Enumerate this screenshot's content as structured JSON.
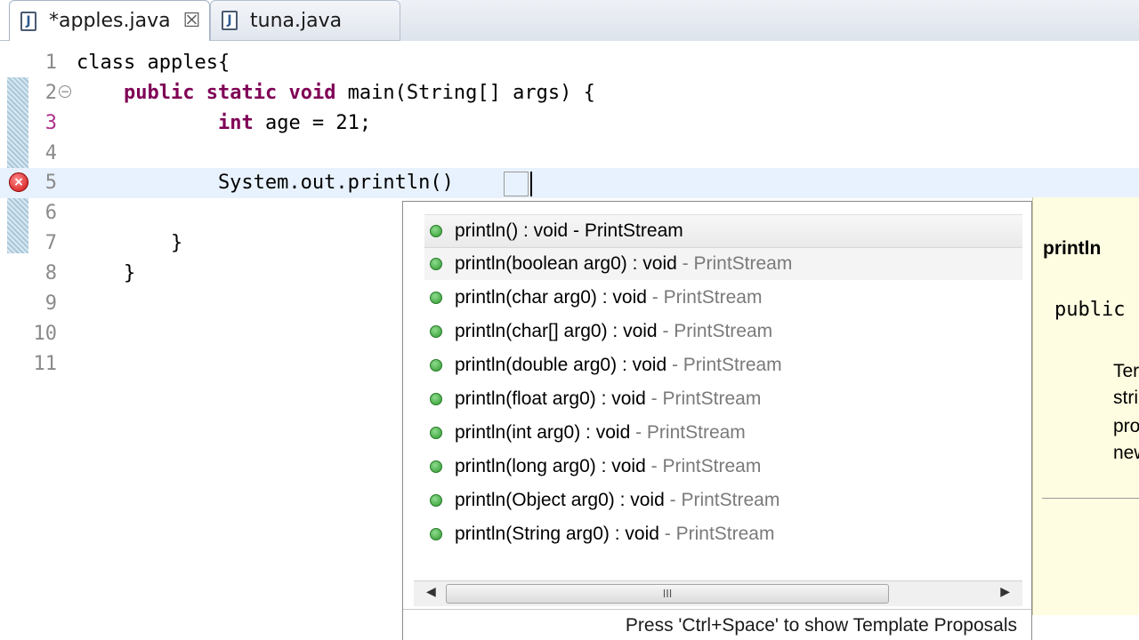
{
  "tabs": [
    {
      "label": "*apples.java",
      "active": true,
      "close_glyph": "☒",
      "icon": "java-file-icon"
    },
    {
      "label": "tuna.java",
      "active": false,
      "icon": "java-file-icon"
    }
  ],
  "editor": {
    "lines": [
      {
        "num": "1",
        "parts": [
          {
            "kw": false,
            "text": "class apples{"
          }
        ]
      },
      {
        "num": "2",
        "parts": [
          {
            "kw": false,
            "text": "    "
          },
          {
            "kw": true,
            "text": "public"
          },
          {
            "kw": false,
            "text": " "
          },
          {
            "kw": true,
            "text": "static"
          },
          {
            "kw": false,
            "text": " "
          },
          {
            "kw": true,
            "text": "void"
          },
          {
            "kw": false,
            "text": " main(String[] args) {"
          }
        ]
      },
      {
        "num": "3",
        "parts": [
          {
            "kw": false,
            "text": "            "
          },
          {
            "kw": true,
            "text": "int"
          },
          {
            "kw": false,
            "text": " age = 21;"
          }
        ]
      },
      {
        "num": "4",
        "parts": [
          {
            "kw": false,
            "text": ""
          }
        ]
      },
      {
        "num": "5",
        "parts": [
          {
            "kw": false,
            "text": "            System.out.println()"
          }
        ]
      },
      {
        "num": "6",
        "parts": [
          {
            "kw": false,
            "text": ""
          }
        ]
      },
      {
        "num": "7",
        "parts": [
          {
            "kw": false,
            "text": "        }"
          }
        ]
      },
      {
        "num": "8",
        "parts": [
          {
            "kw": false,
            "text": "    }"
          }
        ]
      },
      {
        "num": "9",
        "parts": [
          {
            "kw": false,
            "text": ""
          }
        ]
      },
      {
        "num": "10",
        "parts": [
          {
            "kw": false,
            "text": ""
          }
        ]
      },
      {
        "num": "11",
        "parts": [
          {
            "kw": false,
            "text": ""
          }
        ]
      }
    ],
    "fold_glyph": "−",
    "error_glyph": "×"
  },
  "completion": {
    "items": [
      {
        "main": "println() : void - PrintStream",
        "qual": ""
      },
      {
        "main": "println(boolean arg0) : void",
        "qual": " - PrintStream"
      },
      {
        "main": "println(char arg0) : void",
        "qual": " - PrintStream"
      },
      {
        "main": "println(char[] arg0) : void",
        "qual": " - PrintStream"
      },
      {
        "main": "println(double arg0) : void",
        "qual": " - PrintStream"
      },
      {
        "main": "println(float arg0) : void",
        "qual": " - PrintStream"
      },
      {
        "main": "println(int arg0) : void",
        "qual": " - PrintStream"
      },
      {
        "main": "println(long arg0) : void",
        "qual": " - PrintStream"
      },
      {
        "main": "println(Object arg0) : void",
        "qual": " - PrintStream"
      },
      {
        "main": "println(String arg0) : void",
        "qual": " - PrintStream"
      }
    ],
    "scroll_left": "◀",
    "scroll_right": "▶",
    "scroll_grip": "III",
    "status": "Press 'Ctrl+Space' to show Template Proposals"
  },
  "javadoc": {
    "title": "println",
    "signature": "public",
    "desc_lines": [
      "Ter",
      "stri",
      "pro",
      "new"
    ]
  }
}
